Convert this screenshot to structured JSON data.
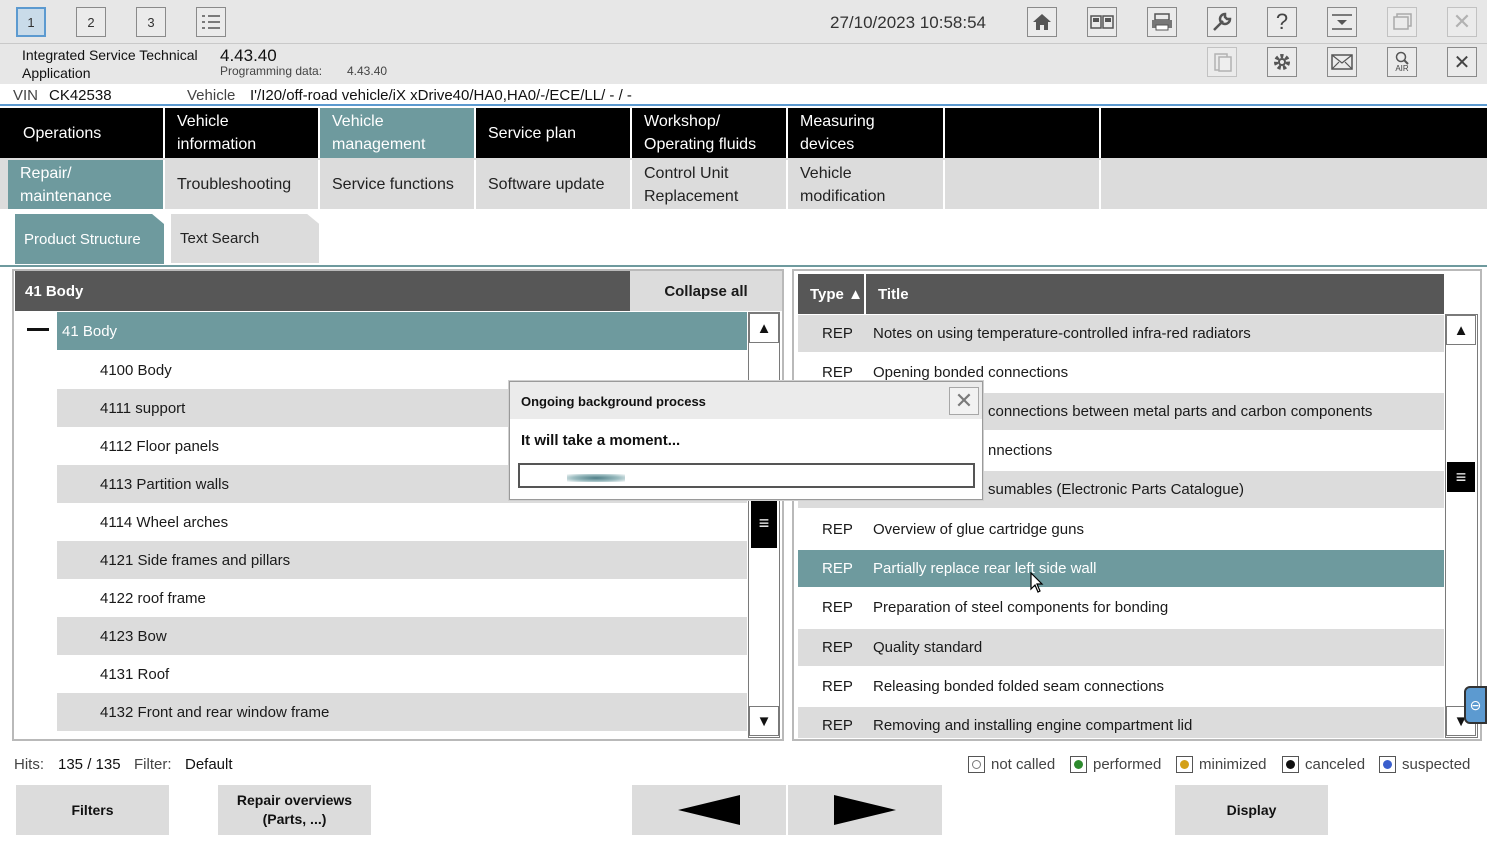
{
  "toolbar": {
    "tabs": [
      "1",
      "2",
      "3"
    ],
    "datetime": "27/10/2023 10:58:54",
    "icons": [
      "list-icon",
      "home-icon",
      "split-view-icon",
      "print-icon",
      "wrench-icon",
      "help-icon",
      "download-icon",
      "window-icon",
      "close-icon"
    ]
  },
  "info": {
    "app_name": "Integrated Service Technical Application",
    "version": "4.43.40",
    "programming_label": "Programming data:",
    "programming_value": "4.43.40",
    "icons": [
      "clipboard-icon",
      "settings-icon",
      "mail-icon",
      "air-icon",
      "close-icon"
    ],
    "air_label": "AIR"
  },
  "vehicle": {
    "vin_label": "VIN",
    "vin_value": "CK42538",
    "vehicle_label": "Vehicle",
    "vehicle_value": "I'/I20/off-road vehicle/iX xDrive40/HA0,HA0/-/ECE/LL/ - / -"
  },
  "main_nav": [
    {
      "label": "Operations",
      "active": false
    },
    {
      "label": "Vehicle information",
      "active": false
    },
    {
      "label": "Vehicle management",
      "active": true
    },
    {
      "label": "Service plan",
      "active": false
    },
    {
      "label": "Workshop/ Operating fluids",
      "active": false
    },
    {
      "label": "Measuring devices",
      "active": false
    }
  ],
  "sub_nav": [
    {
      "label": "Repair/ maintenance",
      "active": true
    },
    {
      "label": "Troubleshooting",
      "active": false
    },
    {
      "label": "Service functions",
      "active": false
    },
    {
      "label": "Software update",
      "active": false
    },
    {
      "label": "Control Unit Replacement",
      "active": false
    },
    {
      "label": "Vehicle modification",
      "active": false
    }
  ],
  "structure_tabs": [
    {
      "label": "Product Structure",
      "active": true
    },
    {
      "label": "Text Search",
      "active": false
    }
  ],
  "tree": {
    "header": "41 Body",
    "collapse_label": "Collapse all",
    "root": "41 Body",
    "items": [
      "4100 Body",
      "4111 support",
      "4112 Floor panels",
      "4113 Partition walls",
      "4114 Wheel arches",
      "4121 Side frames and pillars",
      "4122 roof frame",
      "4123 Bow",
      "4131 Roof",
      "4132 Front and rear window frame"
    ]
  },
  "documents": {
    "type_header": "Type ▲",
    "title_header": "Title",
    "rows": [
      {
        "type": "REP",
        "title": "Notes on using temperature-controlled infra-red radiators"
      },
      {
        "type": "REP",
        "title": "Opening bonded connections"
      },
      {
        "type": "",
        "title": "connections between metal parts and carbon components"
      },
      {
        "type": "",
        "title": "nnections"
      },
      {
        "type": "",
        "title": "sumables (Electronic Parts Catalogue)"
      },
      {
        "type": "REP",
        "title": "Overview of glue cartridge guns"
      },
      {
        "type": "REP",
        "title": "Partially replace rear left side wall"
      },
      {
        "type": "REP",
        "title": "Preparation of steel components for bonding"
      },
      {
        "type": "REP",
        "title": "Quality standard"
      },
      {
        "type": "REP",
        "title": "Releasing bonded folded seam connections"
      },
      {
        "type": "REP",
        "title": "Removing and installing engine compartment lid"
      }
    ],
    "selected_index": 6
  },
  "dialog": {
    "title": "Ongoing background process",
    "message": "It will take a moment..."
  },
  "status": {
    "hits_label": "Hits:",
    "hits_value": "135 / 135",
    "filter_label": "Filter:",
    "filter_value": "Default"
  },
  "legend": [
    {
      "label": "not called",
      "color": "#ffffff"
    },
    {
      "label": "performed",
      "color": "#2e8b2e"
    },
    {
      "label": "minimized",
      "color": "#d4a017"
    },
    {
      "label": "canceled",
      "color": "#111111"
    },
    {
      "label": "suspected",
      "color": "#3a5fcd"
    }
  ],
  "bottom_buttons": {
    "filters": "Filters",
    "repair_overviews": "Repair overviews (Parts, ...)",
    "display": "Display"
  },
  "colors": {
    "accent": "#6e9a9e",
    "header_dark": "#575757",
    "nav_bg": "#000000",
    "row_grey": "#dcdcdc",
    "highlight_blue": "#5c9ad0"
  }
}
